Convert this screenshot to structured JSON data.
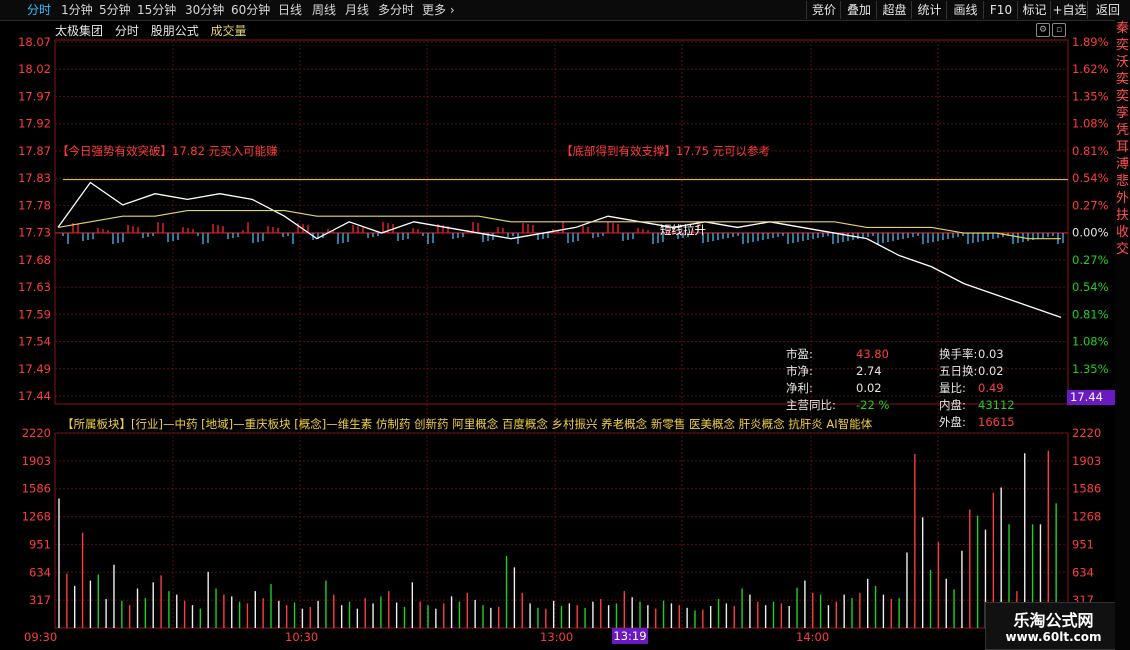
{
  "toolbar": {
    "tabs": [
      "分时",
      "1分钟",
      "5分钟",
      "15分钟",
      "30分钟",
      "60分钟",
      "日线",
      "周线",
      "月线",
      "多分时",
      "更多"
    ],
    "active_tab": "分时",
    "buttons": [
      "竞价",
      "叠加",
      "超盘",
      "统计",
      "画线",
      "F10",
      "标记",
      "+自选",
      "返回"
    ]
  },
  "title": {
    "name": "太极集团",
    "mode": "分时",
    "formula": "股朋公式",
    "indicator": "成交量"
  },
  "colors": {
    "up": "#ff3c3c",
    "down": "#1fd11f",
    "price_line": "#ffffff",
    "avg_line": "#e6d46a",
    "accent": "#2ec3ff"
  },
  "price_axis": {
    "left": [
      "18.07",
      "18.02",
      "17.97",
      "17.92",
      "17.87",
      "17.83",
      "17.78",
      "17.73",
      "17.68",
      "17.63",
      "17.59",
      "17.54",
      "17.49",
      "17.44"
    ],
    "right": [
      "1.89%",
      "1.62%",
      "1.35%",
      "1.08%",
      "0.81%",
      "0.54%",
      "0.27%",
      "0.00%",
      "0.27%",
      "0.54%",
      "0.81%",
      "1.08%",
      "1.35%",
      "1.62%"
    ],
    "current_price": "17.44"
  },
  "volume_axis": {
    "left": [
      "2220",
      "1903",
      "1586",
      "1268",
      "951",
      "634",
      "317"
    ],
    "right": [
      "2220",
      "1903",
      "1586",
      "1268",
      "951",
      "634",
      "317"
    ]
  },
  "time_axis": [
    "09:30",
    "10:30",
    "13:00",
    "14:00"
  ],
  "cursor_time": "13:19",
  "annotations": {
    "signal_left_bracket": "【今日强势有效突破】",
    "signal_left_text": "17.82 元买入可能赚",
    "signal_right_bracket": "【底部得到有效支撑】",
    "signal_right_text": "17.75 元可以参考",
    "middle_label": "短线拉升",
    "sectors": "【所属板块】[行业]—中药 [地域]—重庆板块 [概念]—维生素 仿制药 创新药 阿里概念 百度概念 乡村振兴 养老概念 新零售 医美概念 肝炎概念 抗肝炎 AI智能体"
  },
  "stats": [
    {
      "label": "市盈:",
      "value": "43.80",
      "value_color": "#ff3c3c"
    },
    {
      "label": "市净:",
      "value": "2.74",
      "value_color": "#e6e6e6"
    },
    {
      "label": "净利:",
      "value": "0.02",
      "value_color": "#e6e6e6"
    },
    {
      "label": "主营同比:",
      "value": "-22 %",
      "value_color": "#1fd11f"
    },
    {
      "label": "换手率:",
      "value": "0.03",
      "value_color": "#e6e6e6"
    },
    {
      "label": "五日换:",
      "value": "0.02",
      "value_color": "#e6e6e6"
    },
    {
      "label": "量比:",
      "value": "0.49",
      "value_color": "#ff3c3c"
    },
    {
      "label": "内盘:",
      "value": "43112",
      "value_color": "#1fd11f"
    },
    {
      "label": "外盘:",
      "value": "16615",
      "value_color": "#ff3c3c"
    }
  ],
  "watermark": {
    "line1": "乐淘公式网",
    "line2": "www.60lt.com"
  },
  "sidebar_text": "秦奕沃奕奕孪凭耳溥悲外扶收交",
  "chart_data": {
    "type": "line",
    "title": "太极集团 分时",
    "prev_close": 17.73,
    "ylim": [
      17.44,
      18.07
    ],
    "x": [
      "09:30",
      "09:35",
      "09:40",
      "09:45",
      "09:50",
      "09:55",
      "10:00",
      "10:10",
      "10:20",
      "10:30",
      "10:40",
      "10:50",
      "11:00",
      "11:10",
      "11:20",
      "11:30",
      "13:00",
      "13:10",
      "13:20",
      "13:30",
      "13:40",
      "13:50",
      "14:00",
      "14:10",
      "14:20",
      "14:30",
      "14:35",
      "14:40",
      "14:45",
      "14:50",
      "14:55",
      "15:00"
    ],
    "series": [
      {
        "values": [
          17.74,
          17.82,
          17.78,
          17.8,
          17.79,
          17.8,
          17.79,
          17.76,
          17.72,
          17.75,
          17.73,
          17.75,
          17.74,
          17.73,
          17.72,
          17.73,
          17.74,
          17.76,
          17.75,
          17.74,
          17.75,
          17.74,
          17.75,
          17.74,
          17.73,
          17.72,
          17.69,
          17.67,
          17.64,
          17.62,
          17.6,
          17.58
        ]
      },
      {
        "values": [
          17.74,
          17.75,
          17.76,
          17.76,
          17.77,
          17.77,
          17.77,
          17.77,
          17.76,
          17.76,
          17.76,
          17.76,
          17.76,
          17.76,
          17.75,
          17.75,
          17.75,
          17.75,
          17.75,
          17.75,
          17.75,
          17.75,
          17.75,
          17.75,
          17.75,
          17.74,
          17.74,
          17.74,
          17.73,
          17.73,
          17.72,
          17.72
        ]
      }
    ],
    "volume": {
      "ylim": [
        0,
        2220
      ],
      "values": [
        1475,
        620,
        480,
        1085,
        540,
        610,
        330,
        720,
        310,
        260,
        450,
        340,
        520,
        600,
        420,
        380,
        310,
        260,
        220,
        640,
        450,
        380,
        360,
        300,
        280,
        420,
        340,
        500,
        310,
        260,
        290,
        220,
        240,
        310,
        540,
        380,
        260,
        300,
        220,
        340,
        280,
        360,
        420,
        290,
        240,
        520,
        300,
        260,
        220,
        280,
        360,
        300,
        400,
        320,
        260,
        230,
        240,
        820,
        690,
        400,
        280,
        230,
        220,
        310,
        250,
        280,
        260,
        230,
        300,
        330,
        260,
        280,
        420,
        350,
        300,
        260,
        220,
        310,
        280,
        260,
        230,
        200,
        210,
        250,
        330,
        280,
        250,
        450,
        380,
        300,
        260,
        300,
        280,
        250,
        460,
        540,
        400,
        380,
        260,
        300,
        380,
        340,
        400,
        560,
        480,
        380,
        330,
        340,
        860,
        1980,
        1260,
        660,
        980,
        560,
        440,
        880,
        1350,
        1280,
        1120,
        1540,
        1600,
        1180,
        420,
        1990,
        1180,
        1180,
        2020,
        1420
      ],
      "colors": [
        "w",
        "r",
        "w",
        "r",
        "w",
        "g",
        "w",
        "w",
        "g",
        "r",
        "w",
        "g",
        "w",
        "r",
        "g",
        "w",
        "r",
        "w",
        "g",
        "w",
        "g",
        "r",
        "w",
        "g",
        "r",
        "w",
        "r",
        "g",
        "w",
        "r",
        "g",
        "w",
        "r",
        "w",
        "g",
        "r",
        "w",
        "g",
        "w",
        "r",
        "w",
        "g",
        "r",
        "w",
        "g",
        "w",
        "r",
        "g",
        "w",
        "r",
        "w",
        "g",
        "r",
        "w",
        "g",
        "w",
        "r",
        "g",
        "w",
        "r",
        "w",
        "g",
        "r",
        "w",
        "g",
        "w",
        "r",
        "g",
        "w",
        "r",
        "w",
        "g",
        "r",
        "w",
        "g",
        "w",
        "r",
        "g",
        "w",
        "r",
        "w",
        "g",
        "r",
        "w",
        "g",
        "w",
        "r",
        "g",
        "w",
        "r",
        "w",
        "g",
        "r",
        "w",
        "g",
        "w",
        "r",
        "g",
        "w",
        "r",
        "w",
        "g",
        "r",
        "w",
        "g",
        "w",
        "r",
        "g",
        "w",
        "r",
        "w",
        "g",
        "r",
        "w",
        "g",
        "w",
        "r",
        "g",
        "w",
        "r",
        "w",
        "g",
        "r",
        "w",
        "g",
        "w",
        "r",
        "g"
      ]
    }
  }
}
